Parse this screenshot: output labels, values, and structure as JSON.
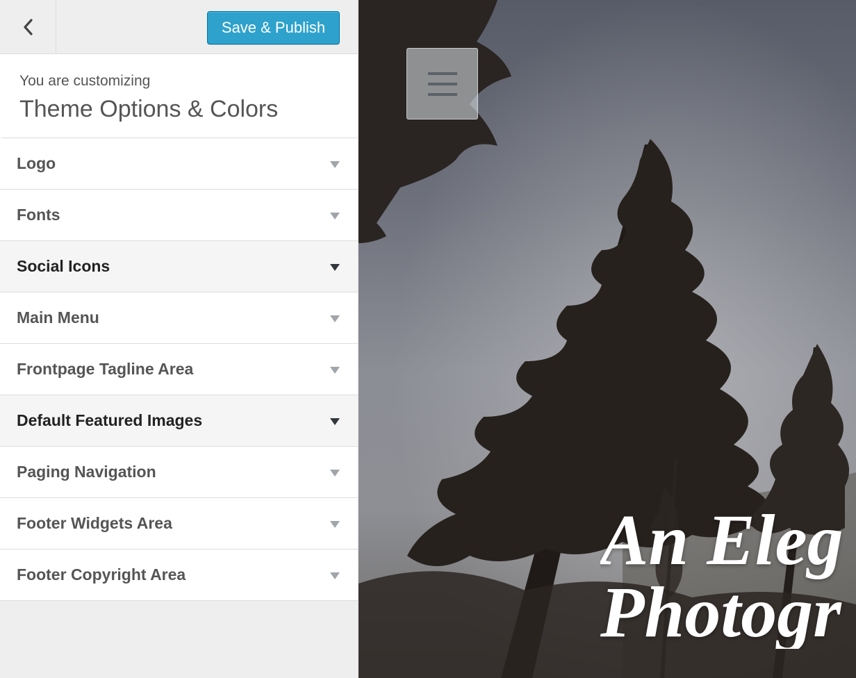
{
  "header": {
    "back_icon": "chevron-left-icon",
    "save_label": "Save & Publish",
    "save_color": "#2ea2cc"
  },
  "info": {
    "pre": "You are customizing",
    "title": "Theme Options & Colors"
  },
  "sections": [
    {
      "label": "Logo",
      "active": false
    },
    {
      "label": "Fonts",
      "active": false
    },
    {
      "label": "Social Icons",
      "active": true
    },
    {
      "label": "Main Menu",
      "active": false
    },
    {
      "label": "Frontpage Tagline Area",
      "active": false
    },
    {
      "label": "Default Featured Images",
      "active": true
    },
    {
      "label": "Paging Navigation",
      "active": false
    },
    {
      "label": "Footer Widgets Area",
      "active": false
    },
    {
      "label": "Footer Copyright Area",
      "active": false
    }
  ],
  "preview": {
    "menu_icon": "hamburger-menu-icon",
    "hero_line1": "An Eleg",
    "hero_line2": "Photogr"
  }
}
